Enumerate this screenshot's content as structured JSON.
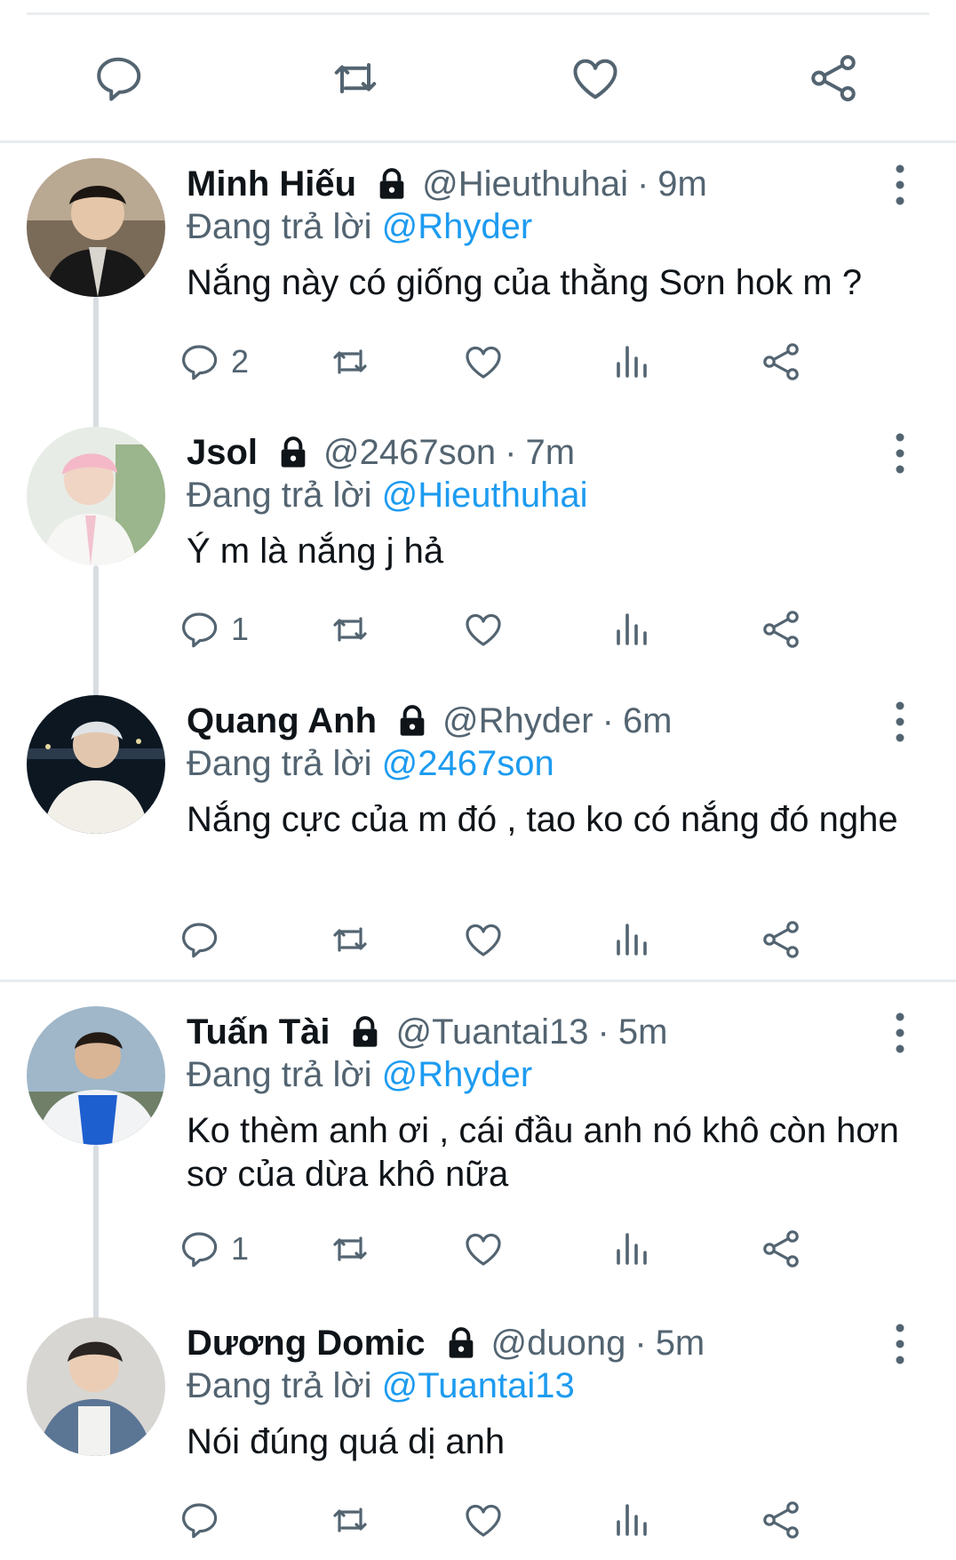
{
  "top_actions": {
    "reply": "reply-icon",
    "retweet": "retweet-icon",
    "like": "heart-icon",
    "share": "share-icon"
  },
  "reply_prefix": "Đang trả lời",
  "colors": {
    "link": "#1d9bf0",
    "secondary": "#536471",
    "text": "#0f1419",
    "thread_line": "#d7dde2"
  },
  "replies": [
    {
      "name": "Minh Hiếu",
      "handle": "@Hieuthuhai",
      "time": "9m",
      "reply_to": "@Rhyder",
      "text": "Nắng này có giống của thằng Sơn hok m ?",
      "reply_count": "2"
    },
    {
      "name": "Jsol",
      "handle": "@2467son",
      "time": "7m",
      "reply_to": "@Hieuthuhai",
      "text": "Ý m là nắng j hả",
      "reply_count": "1"
    },
    {
      "name": "Quang Anh",
      "handle": "@Rhyder",
      "time": "6m",
      "reply_to": "@2467son",
      "text": "Nắng cực của m đó , tao ko có nắng đó nghe",
      "reply_count": ""
    },
    {
      "name": "Tuấn Tài",
      "handle": "@Tuantai13",
      "time": "5m",
      "reply_to": "@Rhyder",
      "text": "Ko thèm anh ơi , cái đầu anh nó khô còn hơn sơ của dừa khô nữa",
      "reply_count": "1"
    },
    {
      "name": "Dương Domic",
      "handle": "@duong",
      "time": "5m",
      "reply_to": "@Tuantai13",
      "text": "Nói đúng quá dị anh",
      "reply_count": ""
    }
  ]
}
